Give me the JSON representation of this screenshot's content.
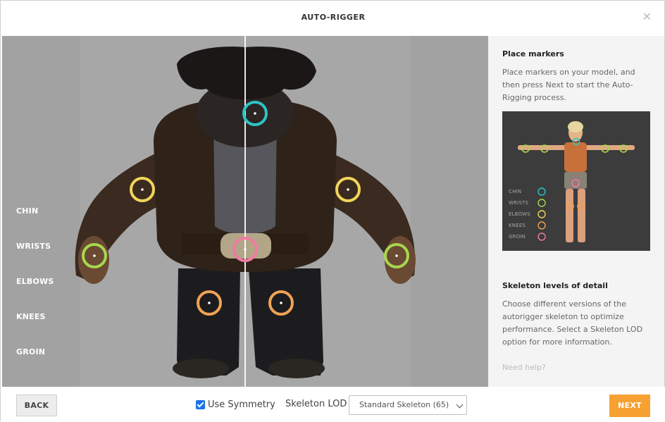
{
  "dialog": {
    "title": "AUTO-RIGGER",
    "close_icon": "close-icon"
  },
  "colors": {
    "chin": "#2ec4c4",
    "wrists": "#a8d64f",
    "elbows": "#f2d45a",
    "knees": "#f0a254",
    "groin": "#f07aa0",
    "next_button": "#f6a132",
    "checkbox": "#1a73e8"
  },
  "markers": [
    {
      "label": "CHIN",
      "color_key": "chin"
    },
    {
      "label": "WRISTS",
      "color_key": "wrists"
    },
    {
      "label": "ELBOWS",
      "color_key": "elbows"
    },
    {
      "label": "KNEES",
      "color_key": "knees"
    },
    {
      "label": "GROIN",
      "color_key": "groin"
    }
  ],
  "side_panel": {
    "place_title": "Place markers",
    "place_text": "Place markers on your model, and then press Next to start the Auto-Rigging process.",
    "preview_labels": [
      "CHIN",
      "WRISTS",
      "ELBOWS",
      "KNEES",
      "GROIN"
    ],
    "lod_title": "Skeleton levels of detail",
    "lod_text": "Choose different versions of the autorigger skeleton to optimize performance. Select a Skeleton LOD option for more information.",
    "help_link": "Need help?"
  },
  "footer": {
    "back_label": "BACK",
    "symmetry_label": "Use Symmetry",
    "symmetry_checked": true,
    "lod_label": "Skeleton LOD",
    "lod_selected": "Standard Skeleton (65)",
    "next_label": "NEXT"
  }
}
